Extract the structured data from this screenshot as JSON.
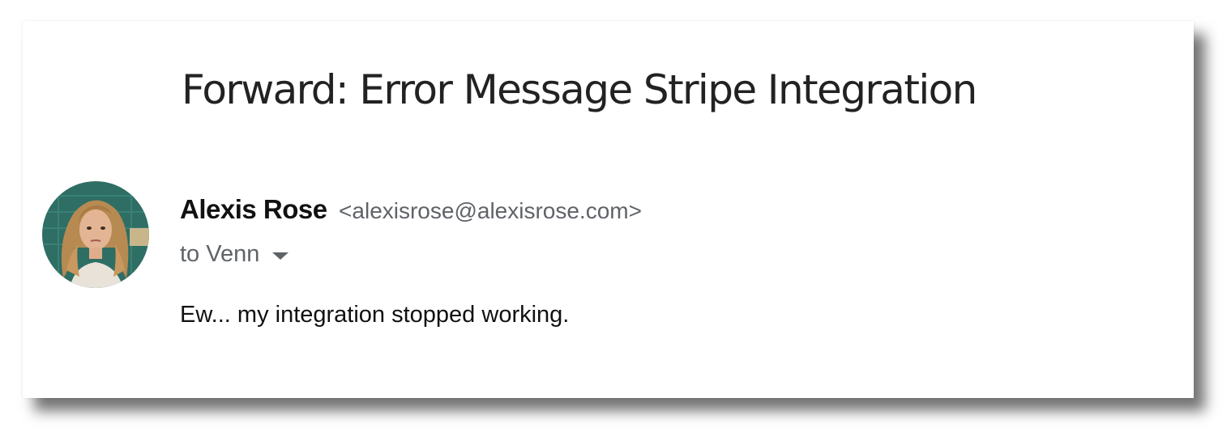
{
  "email": {
    "subject": "Forward: Error Message Stripe Integration",
    "sender": {
      "name": "Alexis Rose",
      "email": "<alexisrose@alexisrose.com>"
    },
    "recipient_text": "to Venn",
    "body": "Ew... my integration stopped working."
  },
  "colors": {
    "subject_text": "#222222",
    "secondary_text": "#5f6368",
    "primary_text": "#111111",
    "avatar_background": "#2e6e64"
  },
  "icons": {
    "recipient_dropdown": "chevron-down-icon"
  }
}
